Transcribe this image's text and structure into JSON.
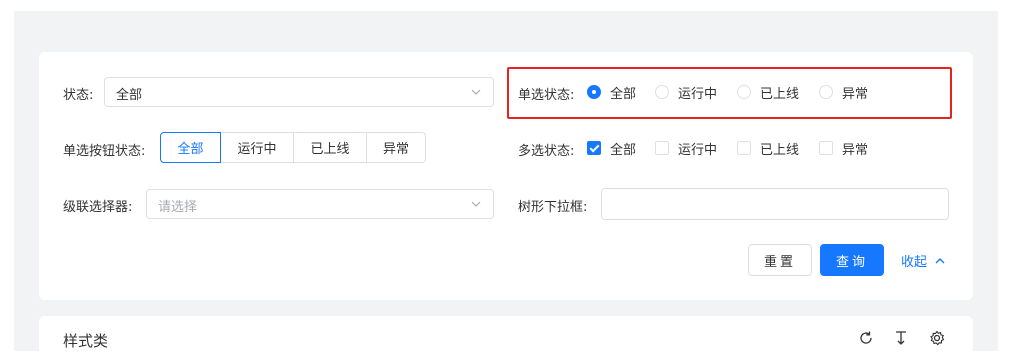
{
  "search": {
    "status_label": "状态:",
    "status_value": "全部",
    "radio_label": "单选状态:",
    "radio_options": [
      "全部",
      "运行中",
      "已上线",
      "异常"
    ],
    "radio_selected": "全部",
    "button_group_label": "单选按钮状态:",
    "button_group_options": [
      "全部",
      "运行中",
      "已上线",
      "异常"
    ],
    "button_group_selected": "全部",
    "checkbox_label": "多选状态:",
    "checkbox_options": [
      "全部",
      "运行中",
      "已上线",
      "异常"
    ],
    "checkbox_checked": [
      "全部"
    ],
    "cascader_label": "级联选择器:",
    "cascader_placeholder": "请选择",
    "tree_select_label": "树形下拉框:",
    "reset_label": "重置",
    "query_label": "查询",
    "collapse_label": "收起"
  },
  "list": {
    "title": "样式类"
  },
  "colors": {
    "primary": "#1677ff",
    "highlight_border": "#e8231f",
    "page_bg": "#f2f3f5"
  },
  "icons": [
    "chevron-down-icon",
    "chevron-up-icon",
    "refresh-icon",
    "column-height-icon",
    "settings-icon"
  ]
}
